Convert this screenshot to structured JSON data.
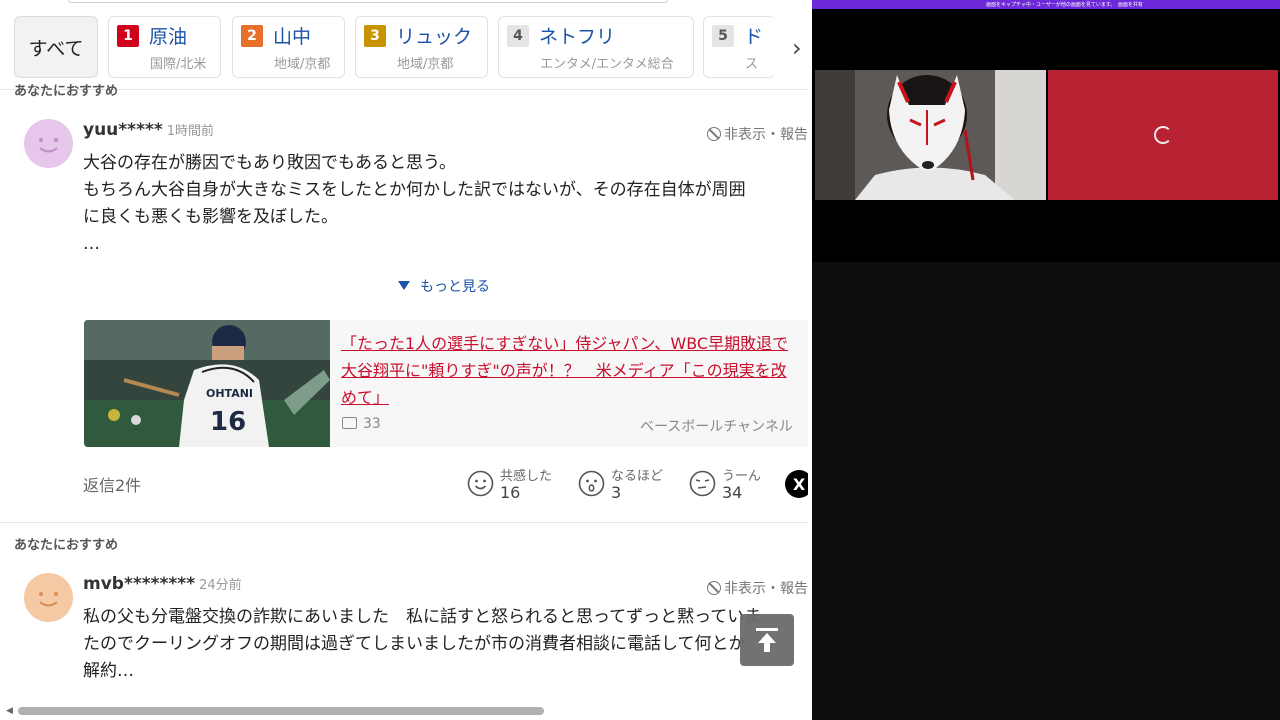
{
  "ranking": {
    "all_label": "すべて",
    "items": [
      {
        "rank": "1",
        "keyword": "原油",
        "category": "国際/北米",
        "color": "#d0021b"
      },
      {
        "rank": "2",
        "keyword": "山中",
        "category": "地域/京都",
        "color": "#e8702a"
      },
      {
        "rank": "3",
        "keyword": "リュック",
        "category": "地域/京都",
        "color": "#c79400"
      },
      {
        "rank": "4",
        "keyword": "ネトフリ",
        "category": "エンタメ/エンタメ総合",
        "color": "#dddddd"
      },
      {
        "rank": "5",
        "keyword": "ド",
        "category": "ス",
        "color": "#dddddd"
      }
    ]
  },
  "comments": [
    {
      "section_label": "あなたにおすすめ",
      "user": "yuu*****",
      "time": "1時間前",
      "hide_report": "非表示・報告",
      "text": "大谷の存在が勝因でもあり敗因でもあると思う。\nもちろん大谷自身が大きなミスをしたとか何かした訳ではないが、その存在自体が周囲\nに良くも悪くも影響を及ぼした。\n…",
      "more": "もっと見る",
      "article": {
        "title": "「たった1人の選手にすぎない」侍ジャパン、WBC早期敗退で大谷翔平に\"頼りすぎ\"の声が！？　米メディア「この現実を改めて」",
        "comments": "33",
        "source": "ベースボールチャンネル",
        "jersey_name": "OHTANI",
        "jersey_number": "16"
      },
      "replies": "返信2件",
      "reactions": [
        {
          "label": "共感した",
          "count": "16"
        },
        {
          "label": "なるほど",
          "count": "3"
        },
        {
          "label": "うーん",
          "count": "34"
        }
      ],
      "share_x": "X"
    },
    {
      "section_label": "あなたにおすすめ",
      "user": "mvb********",
      "time": "24分前",
      "hide_report": "非表示・報告",
      "text": "私の父も分電盤交換の詐欺にあいました　私に話すと怒られると思ってずっと黙っていま\nたのでクーリングオフの期間は過ぎてしまいましたが市の消費者相談に電話して何とか\n解約…"
    }
  ],
  "call": {
    "banner": "画面をキャプチャ中・ユーザーが他の画面を見ています。　画面を共有"
  },
  "colors": {
    "link": "#1b53a8",
    "article_title": "#c8102e",
    "call_accent": "#6d28d9",
    "tile_red": "#b82233"
  }
}
